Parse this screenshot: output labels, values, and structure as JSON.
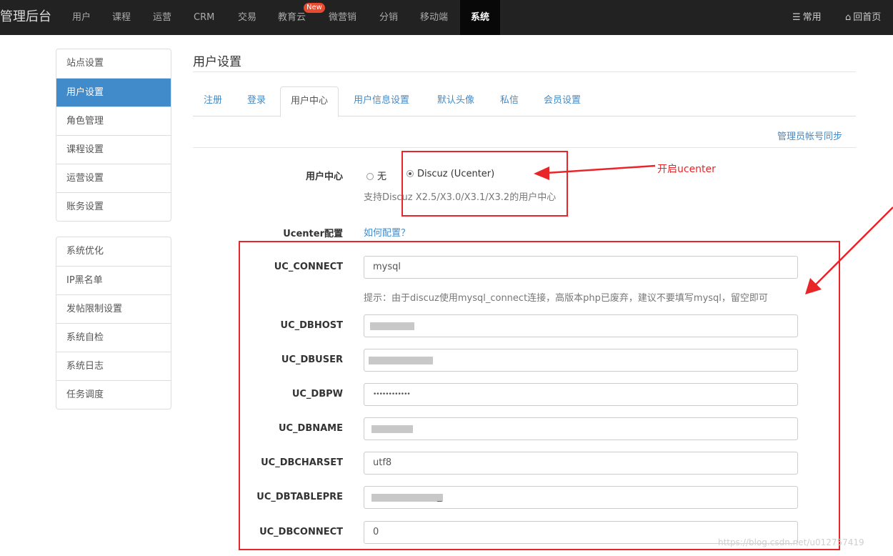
{
  "topnav": {
    "brand": "管理后台",
    "items": [
      "用户",
      "课程",
      "运营",
      "CRM",
      "交易",
      "教育云",
      "微营销",
      "分销",
      "移动端",
      "系统"
    ],
    "badge": "New",
    "right": [
      {
        "icon": "list-icon",
        "glyph": "☰",
        "label": "常用"
      },
      {
        "icon": "home-icon",
        "glyph": "⌂",
        "label": "回首页"
      }
    ]
  },
  "sidebar": {
    "group1": [
      "站点设置",
      "用户设置",
      "角色管理",
      "课程设置",
      "运营设置",
      "账务设置"
    ],
    "group2": [
      "系统优化",
      "IP黑名单",
      "发帖限制设置",
      "系统自检",
      "系统日志",
      "任务调度"
    ]
  },
  "main": {
    "title": "用户设置",
    "tabs": [
      "注册",
      "登录",
      "用户中心",
      "用户信息设置",
      "默认头像",
      "私信",
      "会员设置"
    ],
    "sync_link": "管理员帐号同步",
    "user_center": {
      "label": "用户中心",
      "options": [
        "无",
        "Discuz (Ucenter)"
      ],
      "selected": "Discuz (Ucenter)",
      "help": "支持Discuz X2.5/X3.0/X3.1/X3.2的用户中心"
    },
    "ucenter_config": {
      "label": "Ucenter配置",
      "link": "如何配置？"
    },
    "fields": [
      {
        "label": "UC_CONNECT",
        "value": "mysql",
        "masked": false
      },
      {
        "label": "UC_DBHOST",
        "value": "",
        "masked": true
      },
      {
        "label": "UC_DBUSER",
        "value": "",
        "masked": true
      },
      {
        "label": "UC_DBPW",
        "value": "••••••••••••",
        "masked": false
      },
      {
        "label": "UC_DBNAME",
        "value": "",
        "masked": true
      },
      {
        "label": "UC_DBCHARSET",
        "value": "utf8",
        "masked": false
      },
      {
        "label": "UC_DBTABLEPRE",
        "value": "_",
        "masked": true
      },
      {
        "label": "UC_DBCONNECT",
        "value": "0",
        "masked": false
      }
    ],
    "connect_hint": "提示：由于discuz使用mysql_connect连接，高版本php已废弃，建议不要填写mysql，留空即可"
  },
  "annotation": {
    "text": "开启ucenter",
    "color": "#e8262a"
  },
  "watermark": "https://blog.csdn.net/u012757419",
  "colors": {
    "nav_bg": "#222222",
    "accent": "#428bca",
    "annotation": "#e8262a"
  }
}
